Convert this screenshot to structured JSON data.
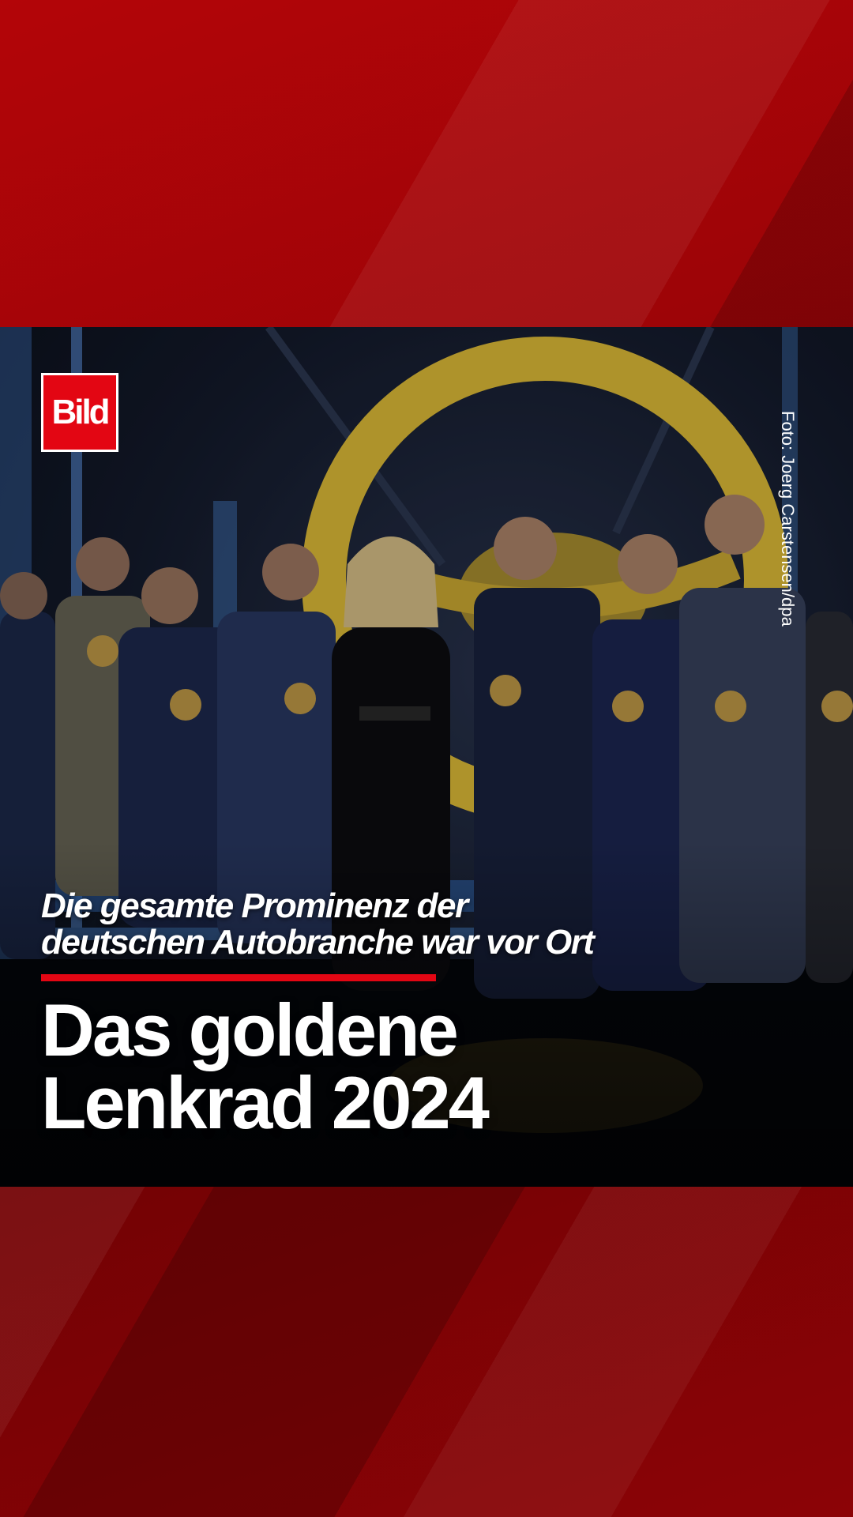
{
  "brand": {
    "logo_text": "Bild",
    "accent_color": "#e30613",
    "background_color": "#8a0406"
  },
  "photo": {
    "credit": "Foto: Joerg Carstensen/dpa"
  },
  "subtitle": {
    "line1": "Die gesamte Prominenz der",
    "line2": "deutschen Autobranche war vor Ort"
  },
  "headline": {
    "line1": "Das goldene",
    "line2": "Lenkrad 2024"
  }
}
